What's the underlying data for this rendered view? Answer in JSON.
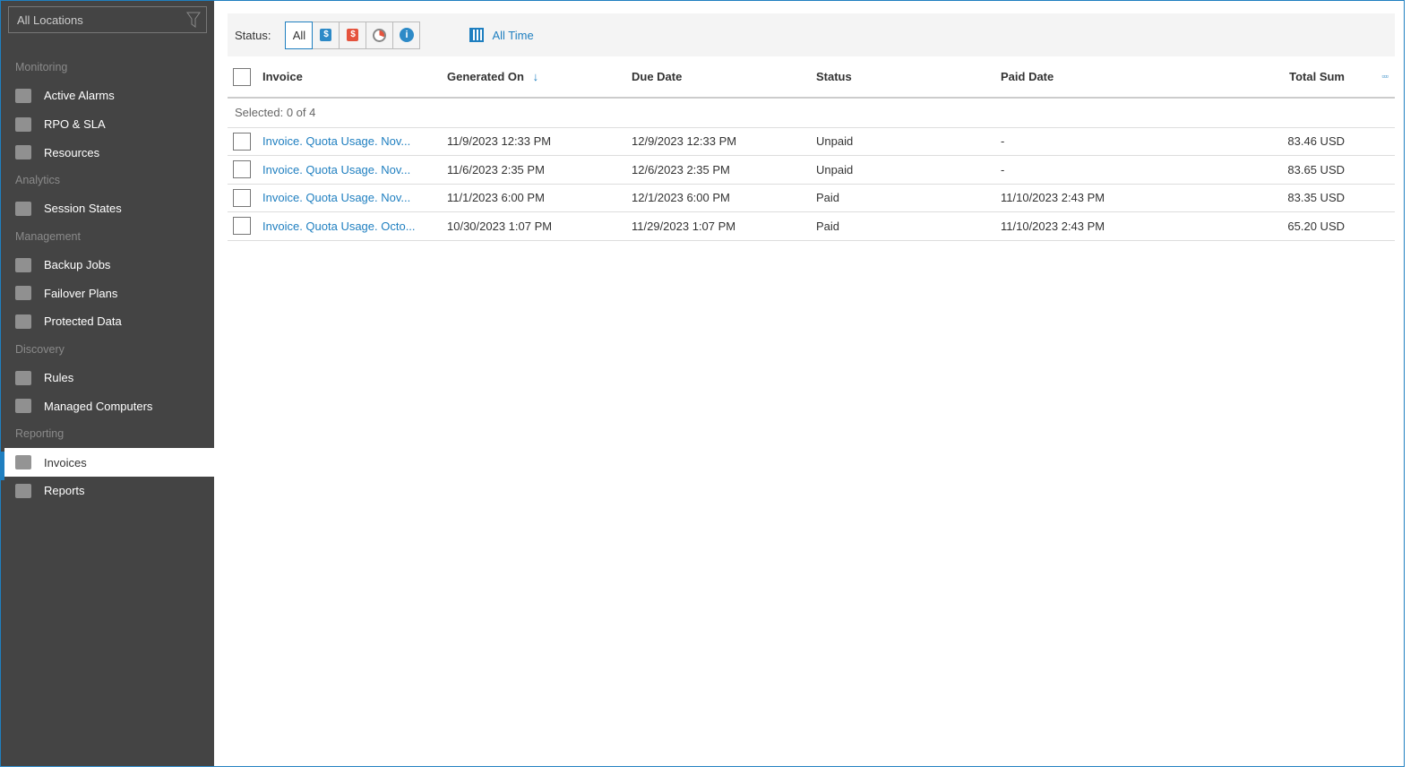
{
  "sidebar": {
    "location": "All Locations",
    "sections": [
      {
        "title": "Monitoring",
        "items": [
          "Active Alarms",
          "RPO & SLA",
          "Resources"
        ]
      },
      {
        "title": "Analytics",
        "items": [
          "Session States"
        ]
      },
      {
        "title": "Management",
        "items": [
          "Backup Jobs",
          "Failover Plans",
          "Protected Data"
        ]
      },
      {
        "title": "Discovery",
        "items": [
          "Rules",
          "Managed Computers"
        ]
      },
      {
        "title": "Reporting",
        "items": [
          "Invoices",
          "Reports"
        ]
      }
    ],
    "active": "Invoices"
  },
  "toolbar": {
    "status_label": "Status:",
    "all": "All",
    "time": "All Time"
  },
  "table": {
    "headers": [
      "Invoice",
      "Generated On",
      "Due Date",
      "Status",
      "Paid Date",
      "Total Sum"
    ],
    "sort_indicator": "↓",
    "selected": "Selected: 0 of 4",
    "rows": [
      [
        "Invoice. Quota Usage. Nov...",
        "11/9/2023 12:33 PM",
        "12/9/2023 12:33 PM",
        "Unpaid",
        "-",
        "83.46 USD"
      ],
      [
        "Invoice. Quota Usage. Nov...",
        "11/6/2023 2:35 PM",
        "12/6/2023 2:35 PM",
        "Unpaid",
        "-",
        "83.65 USD"
      ],
      [
        "Invoice. Quota Usage. Nov...",
        "11/1/2023 6:00 PM",
        "12/1/2023 6:00 PM",
        "Paid",
        "11/10/2023 2:43 PM",
        "83.35 USD"
      ],
      [
        "Invoice. Quota Usage. Octo...",
        "10/30/2023 1:07 PM",
        "11/29/2023 1:07 PM",
        "Paid",
        "11/10/2023 2:43 PM",
        "65.20 USD"
      ]
    ]
  }
}
